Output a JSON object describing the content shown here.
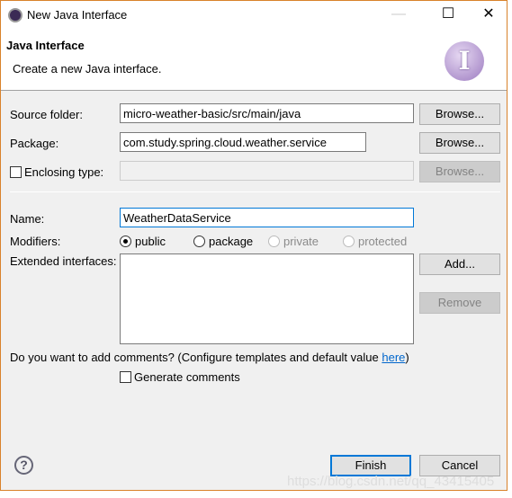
{
  "window": {
    "title": "New Java Interface",
    "minimize": "—",
    "maximize": "☐",
    "close": "✕"
  },
  "header": {
    "title": "Java Interface",
    "description": "Create a new Java interface.",
    "logo": "I"
  },
  "form": {
    "source_folder": {
      "label": "Source folder:",
      "value": "micro-weather-basic/src/main/java",
      "button": "Browse..."
    },
    "package": {
      "label": "Package:",
      "value": "com.study.spring.cloud.weather.service",
      "button": "Browse..."
    },
    "enclosing": {
      "label": "Enclosing type:",
      "value": "",
      "button": "Browse...",
      "checked": false
    },
    "name": {
      "label": "Name:",
      "value": "WeatherDataService"
    },
    "modifiers": {
      "label": "Modifiers:",
      "options": [
        {
          "label": "public",
          "selected": true,
          "enabled": true
        },
        {
          "label": "package",
          "selected": false,
          "enabled": true
        },
        {
          "label": "private",
          "selected": false,
          "enabled": false
        },
        {
          "label": "protected",
          "selected": false,
          "enabled": false
        }
      ]
    },
    "extended": {
      "label": "Extended interfaces:",
      "add": "Add...",
      "remove": "Remove"
    },
    "comments": {
      "question": "Do you want to add comments? (Configure templates and default value ",
      "link": "here",
      "close": ")",
      "checkbox": "Generate comments",
      "checked": false
    }
  },
  "footer": {
    "help": "?",
    "finish": "Finish",
    "cancel": "Cancel"
  },
  "watermark": "https://blog.csdn.net/qq_43415405"
}
